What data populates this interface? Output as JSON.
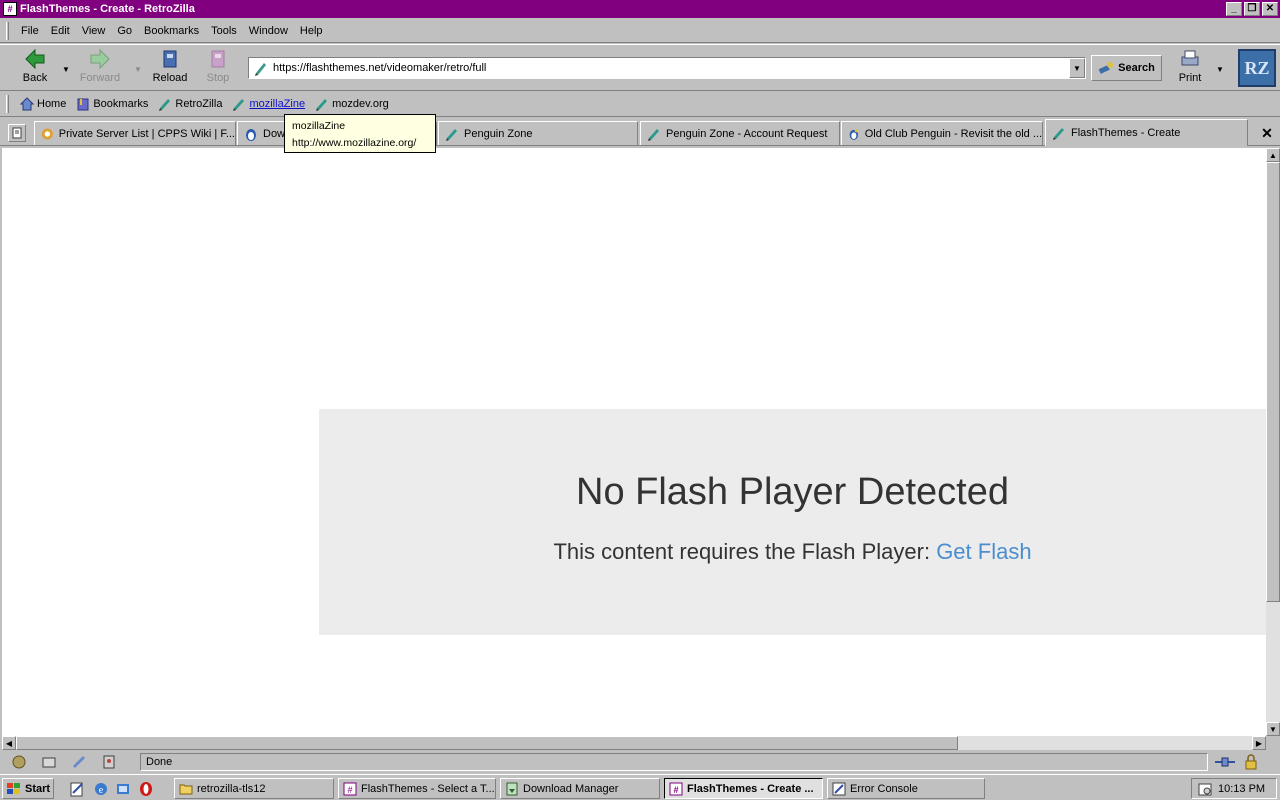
{
  "window": {
    "title": "FlashThemes - Create - RetroZilla"
  },
  "menu": [
    "File",
    "Edit",
    "View",
    "Go",
    "Bookmarks",
    "Tools",
    "Window",
    "Help"
  ],
  "nav": {
    "back": "Back",
    "forward": "Forward",
    "reload": "Reload",
    "stop": "Stop",
    "url": "https://flashthemes.net/videomaker/retro/full",
    "search": "Search",
    "print": "Print",
    "logo": "RZ"
  },
  "personal_toolbar": [
    {
      "label": "Home",
      "icon": "home-icon"
    },
    {
      "label": "Bookmarks",
      "icon": "bookmarks-icon"
    },
    {
      "label": "RetroZilla",
      "icon": "pen-icon"
    },
    {
      "label": "mozillaZine",
      "icon": "pen-icon"
    },
    {
      "label": "mozdev.org",
      "icon": "pen-icon"
    }
  ],
  "tooltip": {
    "title": "mozillaZine",
    "url": "http://www.mozillazine.org/"
  },
  "tabs": [
    "Private Server List | CPPS Wiki | F...",
    "Dow",
    "Penguin Zone",
    "Penguin Zone - Account Request",
    "Old Club Penguin - Revisit the old ...",
    "FlashThemes - Create"
  ],
  "content": {
    "heading": "No Flash Player Detected",
    "message": "This content requires the Flash Player:",
    "link": "Get Flash"
  },
  "status": {
    "text": "Done"
  },
  "taskbar": {
    "start": "Start",
    "tasks": [
      "retrozilla-tls12",
      "FlashThemes - Select a T...",
      "Download Manager",
      "FlashThemes - Create ...",
      "Error Console"
    ],
    "clock": "10:13 PM"
  },
  "colors": {
    "titlebar": "#800080",
    "link": "#4b8ecf",
    "flash_box": "#ececec"
  }
}
